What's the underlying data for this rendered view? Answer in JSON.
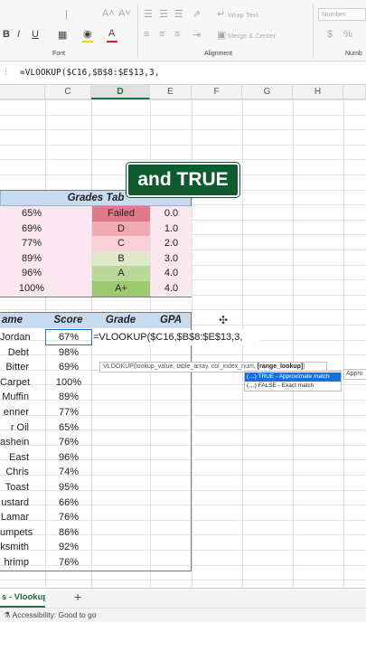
{
  "ribbon": {
    "wrap_text": "Wrap Text",
    "merge_center": "Merge & Center",
    "number_format": "Number",
    "group_font": "Font",
    "group_alignment": "Alignment",
    "group_number": "Numb"
  },
  "formula_bar": {
    "formula": "=VLOOKUP($C16,$B$8:$E$13,3,"
  },
  "columns": [
    "C",
    "D",
    "E",
    "F",
    "G",
    "H"
  ],
  "selected_column": "D",
  "overlay_caption": "and TRUE",
  "grades_tab": {
    "title": "Grades Tab",
    "rows": [
      {
        "score": "65%",
        "grade": "Failed",
        "gpa": "0.0",
        "color": "#e07a8a"
      },
      {
        "score": "69%",
        "grade": "D",
        "gpa": "1.0",
        "color": "#f1aab4"
      },
      {
        "score": "77%",
        "grade": "C",
        "gpa": "2.0",
        "color": "#f8d0d5"
      },
      {
        "score": "89%",
        "grade": "B",
        "gpa": "3.0",
        "color": "#dfe8c8"
      },
      {
        "score": "96%",
        "grade": "A",
        "gpa": "4.0",
        "color": "#bcd79a"
      },
      {
        "score": "100%",
        "grade": "A+",
        "gpa": "4.0",
        "color": "#9cc86f"
      }
    ]
  },
  "students": {
    "headers": {
      "name": "ame",
      "score": "Score",
      "grade": "Grade",
      "gpa": "GPA"
    },
    "editing_formula": "=VLOOKUP($C16,$B$8:$E$13,3,",
    "rows": [
      {
        "name": "Jordan",
        "score": "67%"
      },
      {
        "name": "Debt",
        "score": "98%"
      },
      {
        "name": "Bitter",
        "score": "69%"
      },
      {
        "name": "Carpet",
        "score": "100%"
      },
      {
        "name": "Muffin",
        "score": "89%"
      },
      {
        "name": "enner",
        "score": "77%"
      },
      {
        "name": "r Oil",
        "score": "65%"
      },
      {
        "name": "ashein",
        "score": "76%"
      },
      {
        "name": "East",
        "score": "96%"
      },
      {
        "name": "Chris",
        "score": "74%"
      },
      {
        "name": "Toast",
        "score": "95%"
      },
      {
        "name": "ustard",
        "score": "66%"
      },
      {
        "name": "Lamar",
        "score": "76%"
      },
      {
        "name": "umpets",
        "score": "86%"
      },
      {
        "name": "ksmith",
        "score": "92%"
      },
      {
        "name": "hrimp",
        "score": "76%"
      }
    ]
  },
  "tooltip": {
    "signature": "VLOOKUP(lookup_value, table_array, col_index_num, ",
    "current_arg": "[range_lookup]",
    "close": ")",
    "options": [
      {
        "label": "TRUE - Approximate match",
        "selected": true
      },
      {
        "label": "FALSE - Exact match",
        "selected": false
      }
    ],
    "side_text": "Appro"
  },
  "sheet_tab": "s - Vlookup",
  "add_sheet": "+",
  "status": "Accessibility: Good to go",
  "colors": {
    "excel_green": "#1e7145",
    "header_blue": "#c8dbef",
    "caption_bg": "#0f5a2e"
  }
}
